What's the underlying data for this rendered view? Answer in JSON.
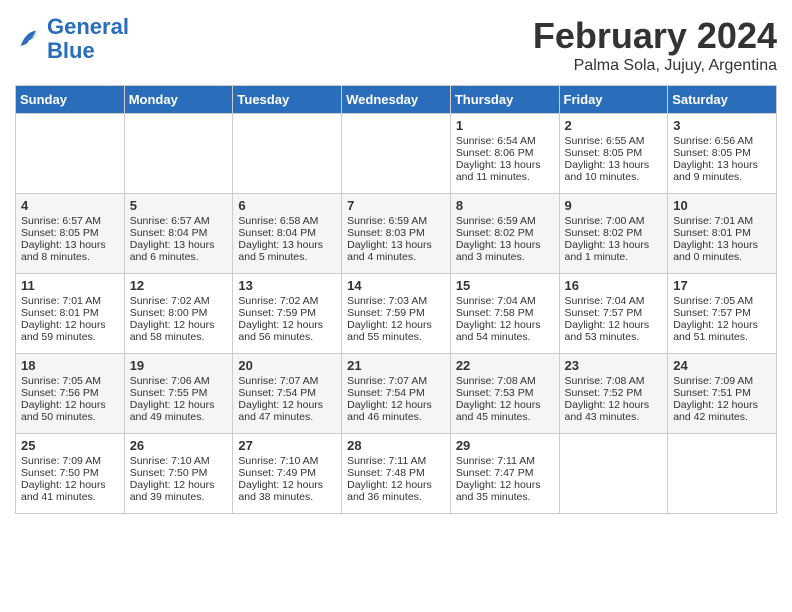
{
  "header": {
    "logo_general": "General",
    "logo_blue": "Blue",
    "month": "February 2024",
    "location": "Palma Sola, Jujuy, Argentina"
  },
  "weekdays": [
    "Sunday",
    "Monday",
    "Tuesday",
    "Wednesday",
    "Thursday",
    "Friday",
    "Saturday"
  ],
  "weeks": [
    [
      {
        "day": "",
        "info": ""
      },
      {
        "day": "",
        "info": ""
      },
      {
        "day": "",
        "info": ""
      },
      {
        "day": "",
        "info": ""
      },
      {
        "day": "1",
        "info": "Sunrise: 6:54 AM\nSunset: 8:06 PM\nDaylight: 13 hours and 11 minutes."
      },
      {
        "day": "2",
        "info": "Sunrise: 6:55 AM\nSunset: 8:05 PM\nDaylight: 13 hours and 10 minutes."
      },
      {
        "day": "3",
        "info": "Sunrise: 6:56 AM\nSunset: 8:05 PM\nDaylight: 13 hours and 9 minutes."
      }
    ],
    [
      {
        "day": "4",
        "info": "Sunrise: 6:57 AM\nSunset: 8:05 PM\nDaylight: 13 hours and 8 minutes."
      },
      {
        "day": "5",
        "info": "Sunrise: 6:57 AM\nSunset: 8:04 PM\nDaylight: 13 hours and 6 minutes."
      },
      {
        "day": "6",
        "info": "Sunrise: 6:58 AM\nSunset: 8:04 PM\nDaylight: 13 hours and 5 minutes."
      },
      {
        "day": "7",
        "info": "Sunrise: 6:59 AM\nSunset: 8:03 PM\nDaylight: 13 hours and 4 minutes."
      },
      {
        "day": "8",
        "info": "Sunrise: 6:59 AM\nSunset: 8:02 PM\nDaylight: 13 hours and 3 minutes."
      },
      {
        "day": "9",
        "info": "Sunrise: 7:00 AM\nSunset: 8:02 PM\nDaylight: 13 hours and 1 minute."
      },
      {
        "day": "10",
        "info": "Sunrise: 7:01 AM\nSunset: 8:01 PM\nDaylight: 13 hours and 0 minutes."
      }
    ],
    [
      {
        "day": "11",
        "info": "Sunrise: 7:01 AM\nSunset: 8:01 PM\nDaylight: 12 hours and 59 minutes."
      },
      {
        "day": "12",
        "info": "Sunrise: 7:02 AM\nSunset: 8:00 PM\nDaylight: 12 hours and 58 minutes."
      },
      {
        "day": "13",
        "info": "Sunrise: 7:02 AM\nSunset: 7:59 PM\nDaylight: 12 hours and 56 minutes."
      },
      {
        "day": "14",
        "info": "Sunrise: 7:03 AM\nSunset: 7:59 PM\nDaylight: 12 hours and 55 minutes."
      },
      {
        "day": "15",
        "info": "Sunrise: 7:04 AM\nSunset: 7:58 PM\nDaylight: 12 hours and 54 minutes."
      },
      {
        "day": "16",
        "info": "Sunrise: 7:04 AM\nSunset: 7:57 PM\nDaylight: 12 hours and 53 minutes."
      },
      {
        "day": "17",
        "info": "Sunrise: 7:05 AM\nSunset: 7:57 PM\nDaylight: 12 hours and 51 minutes."
      }
    ],
    [
      {
        "day": "18",
        "info": "Sunrise: 7:05 AM\nSunset: 7:56 PM\nDaylight: 12 hours and 50 minutes."
      },
      {
        "day": "19",
        "info": "Sunrise: 7:06 AM\nSunset: 7:55 PM\nDaylight: 12 hours and 49 minutes."
      },
      {
        "day": "20",
        "info": "Sunrise: 7:07 AM\nSunset: 7:54 PM\nDaylight: 12 hours and 47 minutes."
      },
      {
        "day": "21",
        "info": "Sunrise: 7:07 AM\nSunset: 7:54 PM\nDaylight: 12 hours and 46 minutes."
      },
      {
        "day": "22",
        "info": "Sunrise: 7:08 AM\nSunset: 7:53 PM\nDaylight: 12 hours and 45 minutes."
      },
      {
        "day": "23",
        "info": "Sunrise: 7:08 AM\nSunset: 7:52 PM\nDaylight: 12 hours and 43 minutes."
      },
      {
        "day": "24",
        "info": "Sunrise: 7:09 AM\nSunset: 7:51 PM\nDaylight: 12 hours and 42 minutes."
      }
    ],
    [
      {
        "day": "25",
        "info": "Sunrise: 7:09 AM\nSunset: 7:50 PM\nDaylight: 12 hours and 41 minutes."
      },
      {
        "day": "26",
        "info": "Sunrise: 7:10 AM\nSunset: 7:50 PM\nDaylight: 12 hours and 39 minutes."
      },
      {
        "day": "27",
        "info": "Sunrise: 7:10 AM\nSunset: 7:49 PM\nDaylight: 12 hours and 38 minutes."
      },
      {
        "day": "28",
        "info": "Sunrise: 7:11 AM\nSunset: 7:48 PM\nDaylight: 12 hours and 36 minutes."
      },
      {
        "day": "29",
        "info": "Sunrise: 7:11 AM\nSunset: 7:47 PM\nDaylight: 12 hours and 35 minutes."
      },
      {
        "day": "",
        "info": ""
      },
      {
        "day": "",
        "info": ""
      }
    ]
  ]
}
